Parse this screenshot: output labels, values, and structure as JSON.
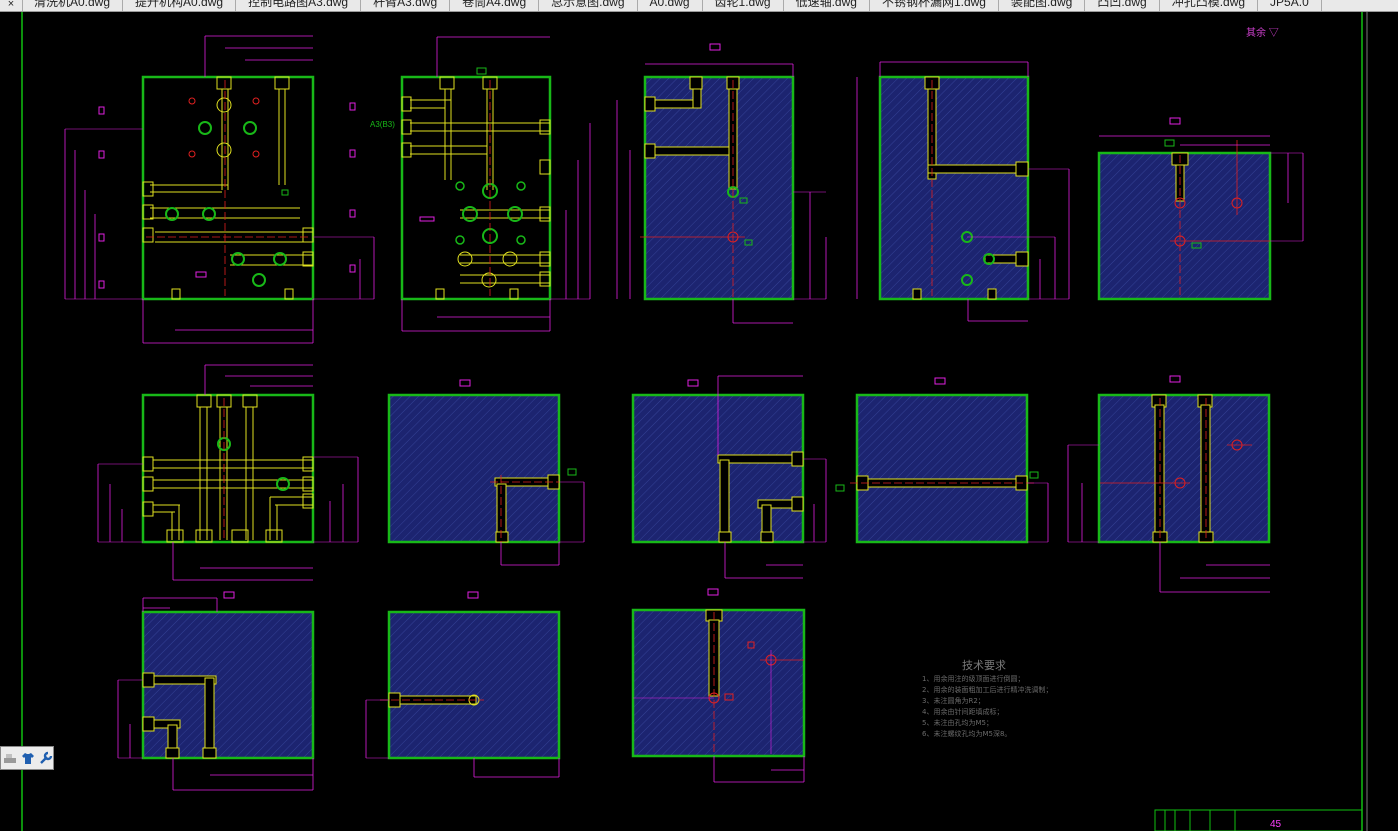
{
  "tabs": [
    "清洗机A0.dwg",
    "提升机构A0.dwg",
    "控制电路图A3.dwg",
    "杆臂A3.dwg",
    "卷筒A4.dwg",
    "总示意图.dwg",
    "A0.dwg",
    "齿轮1.dwg",
    "低速轴.dwg",
    "不锈钢杯漏网1.dwg",
    "装配图.dwg",
    "凸凹.dwg",
    "冲孔凸模.dwg",
    "JP5A.0"
  ],
  "close_glyph": "×",
  "annotation_a3": "A3(B3)",
  "roughness_label": "其余",
  "tech_requirements": {
    "title": "技术要求",
    "items": [
      "1、用余用注的级顶面进行倒圆；",
      "2、用余的装面粗加工后进行精冲洗调制；",
      "3、未注圆角为R2；",
      "4、用余由针间距填成标；",
      "5、未注由孔均为M5；",
      "6、未注螺纹孔均为M5深8。"
    ]
  },
  "sheet_number": "45",
  "colors": {
    "outline": "#18b818",
    "hatch": "#1c2470",
    "dimension": "#e020e0",
    "center": "#e02020",
    "hole": "#e0e020",
    "frame": "#10c010"
  },
  "icons": [
    "floor-icon",
    "shirt-icon",
    "wrench-icon"
  ]
}
